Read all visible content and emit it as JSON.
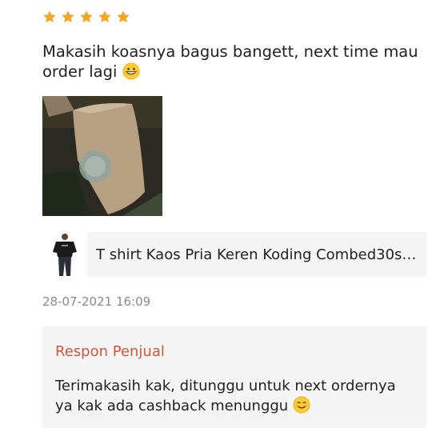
{
  "review": {
    "rating": 5,
    "rating_max": 5,
    "star_color": "#f5a623",
    "text": "Makasih koasnya bagus bangett, next time mau order lagi",
    "emoji_icon": "grinning-face-icon"
  },
  "product": {
    "name": "T shirt Kaos Pria Keren Koding Combed30s S..."
  },
  "timestamp": "28-07-2021 16:09",
  "seller_response": {
    "title": "Respon Penjual",
    "title_color": "#d0553a",
    "text": "Terimakasih kak, ditunggu untuk next ordernya ya kak ada cashback menunggu",
    "emoji_icon": "smiling-face-icon"
  }
}
